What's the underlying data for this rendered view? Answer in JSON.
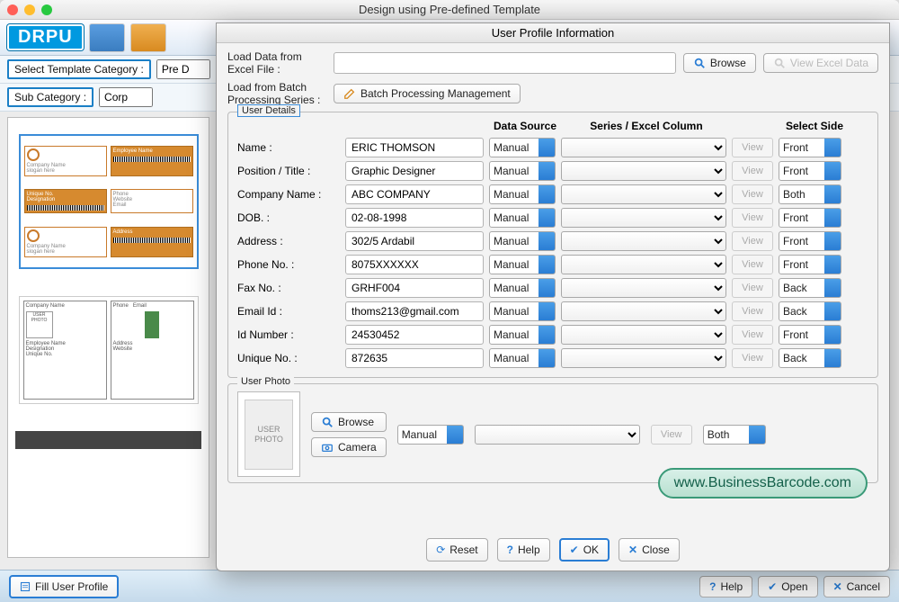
{
  "mainWindow": {
    "title": "Design using Pre-defined Template",
    "logo": "DRPU"
  },
  "category": {
    "templateLabel": "Select Template Category :",
    "templateValue": "Pre D",
    "subLabel": "Sub Category :",
    "subValue": "Corp"
  },
  "footer": {
    "fillProfile": "Fill User Profile",
    "help": "Help",
    "open": "Open",
    "cancel": "Cancel"
  },
  "modal": {
    "title": "User Profile Information",
    "loadExcelLabel": "Load Data from Excel File :",
    "browse": "Browse",
    "viewExcel": "View Excel Data",
    "loadBatchLabel": "Load from Batch Processing Series :",
    "batchBtn": "Batch Processing Management",
    "userDetailsLegend": "User Details",
    "headers": {
      "ds": "Data Source",
      "sc": "Series / Excel Column",
      "side": "Select Side"
    },
    "fields": [
      {
        "label": "Name :",
        "value": "ERIC THOMSON",
        "ds": "Manual",
        "side": "Front"
      },
      {
        "label": "Position / Title :",
        "value": "Graphic Designer",
        "ds": "Manual",
        "side": "Front"
      },
      {
        "label": "Company Name :",
        "value": "ABC COMPANY",
        "ds": "Manual",
        "side": "Both"
      },
      {
        "label": "DOB.  :",
        "value": "02-08-1998",
        "ds": "Manual",
        "side": "Front"
      },
      {
        "label": "Address :",
        "value": "302/5 Ardabil",
        "ds": "Manual",
        "side": "Front"
      },
      {
        "label": "Phone No. :",
        "value": "8075XXXXXX",
        "ds": "Manual",
        "side": "Front"
      },
      {
        "label": "Fax No. :",
        "value": "GRHF004",
        "ds": "Manual",
        "side": "Back"
      },
      {
        "label": "Email Id :",
        "value": "thoms213@gmail.com",
        "ds": "Manual",
        "side": "Back"
      },
      {
        "label": "Id Number  :",
        "value": "24530452",
        "ds": "Manual",
        "side": "Front"
      },
      {
        "label": "Unique No. :",
        "value": "872635",
        "ds": "Manual",
        "side": "Back"
      }
    ],
    "viewBtn": "View",
    "userPhotoLegend": "User Photo",
    "photoPlaceholder": "USER PHOTO",
    "photoBrowse": "Browse",
    "photoCamera": "Camera",
    "photoDs": "Manual",
    "photoSide": "Both",
    "footerBtns": {
      "reset": "Reset",
      "help": "Help",
      "ok": "OK",
      "close": "Close"
    }
  },
  "watermark": "www.BusinessBarcode.com"
}
